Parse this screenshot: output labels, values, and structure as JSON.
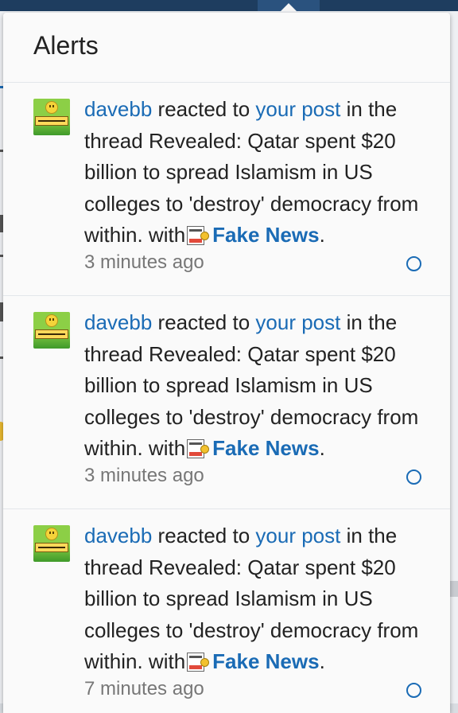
{
  "panel": {
    "title": "Alerts"
  },
  "alerts": [
    {
      "user": "davebb",
      "action": "reacted to",
      "target_link": "your post",
      "middle_text": "in the thread Revealed: Qatar spent $20 billion to spread Islamism in US colleges to 'destroy' democracy from within. with",
      "reaction_icon": "fake-news-icon",
      "reaction": "Fake News",
      "end": ".",
      "time": "3 minutes ago"
    },
    {
      "user": "davebb",
      "action": "reacted to",
      "target_link": "your post",
      "middle_text": "in the thread Revealed: Qatar spent $20 billion to spread Islamism in US colleges to 'destroy' democracy from within. with",
      "reaction_icon": "fake-news-icon",
      "reaction": "Fake News",
      "end": ".",
      "time": "3 minutes ago"
    },
    {
      "user": "davebb",
      "action": "reacted to",
      "target_link": "your post",
      "middle_text": "in the thread Revealed: Qatar spent $20 billion to spread Islamism in US colleges to 'destroy' democracy from within. with",
      "reaction_icon": "fake-news-icon",
      "reaction": "Fake News",
      "end": ".",
      "time": "7 minutes ago"
    }
  ],
  "colors": {
    "link": "#1a6bb5",
    "header_bar": "#1e3d5f",
    "unread_dot": "#1a6bb5"
  }
}
